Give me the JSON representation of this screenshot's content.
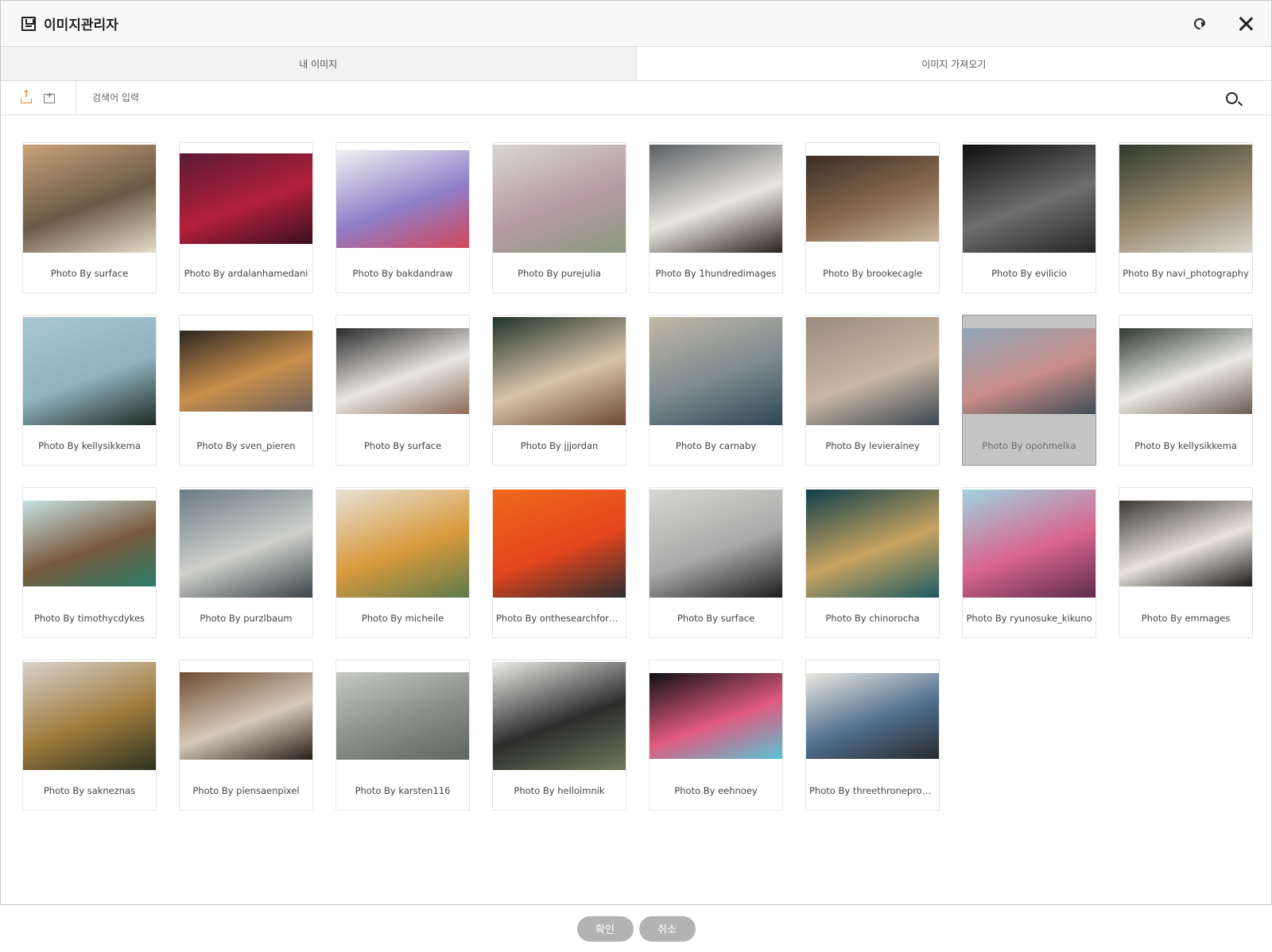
{
  "window": {
    "title": "이미지관리자",
    "title_icon": "save-icon",
    "refresh_icon": "refresh-icon",
    "close_icon": "close-icon"
  },
  "tabs": [
    {
      "label": "내 이미지",
      "active": true
    },
    {
      "label": "이미지 가져오기",
      "active": false
    }
  ],
  "toolbar": {
    "upload_icon": "upload-icon",
    "folder_icon": "folder-add-icon",
    "search_placeholder": "검색어 입력",
    "search_icon": "search-icon"
  },
  "images": [
    {
      "caption": "Photo By surface",
      "selected": false,
      "colors": [
        "#c9a27a",
        "#6b5a45",
        "#e8dccb"
      ]
    },
    {
      "caption": "Photo By ardalanhamedani",
      "selected": false,
      "colors": [
        "#5a1a36",
        "#b3203a",
        "#3a0f22"
      ]
    },
    {
      "caption": "Photo By bakdandraw",
      "selected": false,
      "colors": [
        "#f2f2f2",
        "#8e7fc9",
        "#d4465a"
      ]
    },
    {
      "caption": "Photo By purejulia",
      "selected": false,
      "colors": [
        "#d8d6d0",
        "#b79aa3",
        "#8a9a7e"
      ]
    },
    {
      "caption": "Photo By 1hundredimages",
      "selected": false,
      "colors": [
        "#5b5e62",
        "#e9e6e1",
        "#2a221d"
      ]
    },
    {
      "caption": "Photo By brookecagle",
      "selected": false,
      "colors": [
        "#3a2e25",
        "#8a6a4d",
        "#c9b79f"
      ]
    },
    {
      "caption": "Photo By evilicio",
      "selected": false,
      "colors": [
        "#0e0e0e",
        "#6e6e6e",
        "#262626"
      ]
    },
    {
      "caption": "Photo By navi_photography",
      "selected": false,
      "colors": [
        "#2f3b2c",
        "#9a8a6d",
        "#d9d7cf"
      ]
    },
    {
      "caption": "Photo By kellysikkema",
      "selected": false,
      "colors": [
        "#a9c7d2",
        "#8fb3c0",
        "#1e2a22"
      ]
    },
    {
      "caption": "Photo By sven_pieren",
      "selected": false,
      "colors": [
        "#2d2823",
        "#c98e4c",
        "#6c625a"
      ]
    },
    {
      "caption": "Photo By surface",
      "selected": false,
      "colors": [
        "#2a2a2a",
        "#e8e6e4",
        "#8a6a55"
      ]
    },
    {
      "caption": "Photo By jjjordan",
      "selected": false,
      "colors": [
        "#1e3328",
        "#d9c3a8",
        "#6a4a32"
      ]
    },
    {
      "caption": "Photo By carnaby",
      "selected": false,
      "colors": [
        "#c2b8a6",
        "#7c8a8f",
        "#2f4654"
      ]
    },
    {
      "caption": "Photo By levierainey",
      "selected": false,
      "colors": [
        "#9b8b7d",
        "#c9b7a3",
        "#3b4652"
      ]
    },
    {
      "caption": "Photo By opohmelka",
      "selected": true,
      "colors": [
        "#8fa6b8",
        "#c98d86",
        "#3f4c58"
      ]
    },
    {
      "caption": "Photo By kellysikkema",
      "selected": false,
      "colors": [
        "#2e3a34",
        "#ebe9e4",
        "#6b5b52"
      ]
    },
    {
      "caption": "Photo By timothycdykes",
      "selected": false,
      "colors": [
        "#c6e3e4",
        "#7a5a3d",
        "#2b7d6c"
      ]
    },
    {
      "caption": "Photo By purzlbaum",
      "selected": false,
      "colors": [
        "#6b7b84",
        "#cfd0cc",
        "#3b4347"
      ]
    },
    {
      "caption": "Photo By micheile",
      "selected": false,
      "colors": [
        "#e8e1d5",
        "#d89a3c",
        "#5f7a4c"
      ]
    },
    {
      "caption": "Photo By onthesearchforpixels",
      "selected": false,
      "colors": [
        "#f0691b",
        "#e4451d",
        "#2d2e31"
      ]
    },
    {
      "caption": "Photo By surface",
      "selected": false,
      "colors": [
        "#d7d6d3",
        "#a9aaa9",
        "#1d1d1f"
      ]
    },
    {
      "caption": "Photo By chinorocha",
      "selected": false,
      "colors": [
        "#0f3f4a",
        "#c8a360",
        "#1d5b63"
      ]
    },
    {
      "caption": "Photo By ryunosuke_kikuno",
      "selected": false,
      "colors": [
        "#9fd3e0",
        "#d9658e",
        "#5d2d4a"
      ]
    },
    {
      "caption": "Photo By emmages",
      "selected": false,
      "colors": [
        "#3c3835",
        "#e8e3de",
        "#1d1b19"
      ]
    },
    {
      "caption": "Photo By sakneznas",
      "selected": false,
      "colors": [
        "#d8d2ca",
        "#a07a3c",
        "#2c3322"
      ]
    },
    {
      "caption": "Photo By piensaenpixel",
      "selected": false,
      "colors": [
        "#6f4c32",
        "#d6c9b8",
        "#2a1f18"
      ]
    },
    {
      "caption": "Photo By karsten116",
      "selected": false,
      "colors": [
        "#c6c8c5",
        "#8a8c87",
        "#5e6661"
      ]
    },
    {
      "caption": "Photo By helloimnik",
      "selected": false,
      "colors": [
        "#ececea",
        "#2c2c2c",
        "#6e7a5a"
      ]
    },
    {
      "caption": "Photo By eehnoey",
      "selected": false,
      "colors": [
        "#101014",
        "#e05a7f",
        "#58c4d6"
      ]
    },
    {
      "caption": "Photo By threethroneproductions",
      "selected": false,
      "colors": [
        "#ece7e0",
        "#4e6f8f",
        "#2a2a2c"
      ]
    }
  ],
  "footer": {
    "confirm_label": "확인",
    "cancel_label": "취소"
  },
  "colors": {
    "accent": "#f08a24",
    "button_bg": "#b3b3b3",
    "selected_card": "#c4c4c4"
  }
}
